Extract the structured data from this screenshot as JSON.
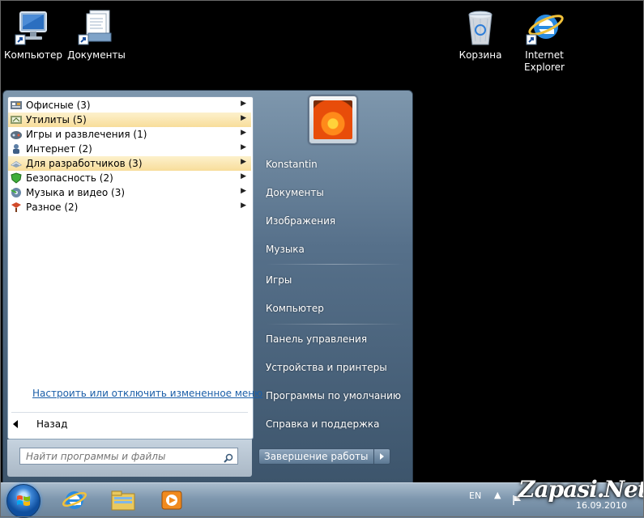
{
  "desktop": {
    "icons": [
      {
        "label": "Компьютер",
        "icon": "computer-icon"
      },
      {
        "label": "Документы",
        "icon": "documents-icon"
      },
      {
        "label": "Корзина",
        "icon": "recycle-bin-icon"
      },
      {
        "label": "Internet Explorer",
        "icon": "internet-explorer-icon"
      }
    ]
  },
  "start_menu": {
    "programs": [
      {
        "label": "Офисные (3)",
        "icon": "office-icon",
        "highlighted": false
      },
      {
        "label": "Утилиты (5)",
        "icon": "utilities-icon",
        "highlighted": true
      },
      {
        "label": "Игры и развлечения (1)",
        "icon": "games-icon",
        "highlighted": false
      },
      {
        "label": "Интернет (2)",
        "icon": "internet-icon",
        "highlighted": false
      },
      {
        "label": "Для разработчиков (3)",
        "icon": "developers-icon",
        "highlighted": true
      },
      {
        "label": "Безопасность (2)",
        "icon": "security-shield-icon",
        "highlighted": false
      },
      {
        "label": "Музыка и видео (3)",
        "icon": "music-video-icon",
        "highlighted": false
      },
      {
        "label": "Разное (2)",
        "icon": "misc-icon",
        "highlighted": false
      }
    ],
    "customize_link": "Настроить или отключить измененное меню",
    "back_label": "Назад",
    "search_placeholder": "Найти программы и файлы",
    "right_items": [
      "Konstantin",
      "Документы",
      "Изображения",
      "Музыка",
      "Игры",
      "Компьютер",
      "Панель управления",
      "Устройства и принтеры",
      "Программы по умолчанию",
      "Справка и поддержка"
    ],
    "shutdown_label": "Завершение работы"
  },
  "taskbar": {
    "language": "EN",
    "date": "16.09.2010",
    "pinned": [
      "internet-explorer-icon",
      "explorer-folder-icon",
      "media-player-icon"
    ]
  },
  "watermark": "Zapasi.Net"
}
